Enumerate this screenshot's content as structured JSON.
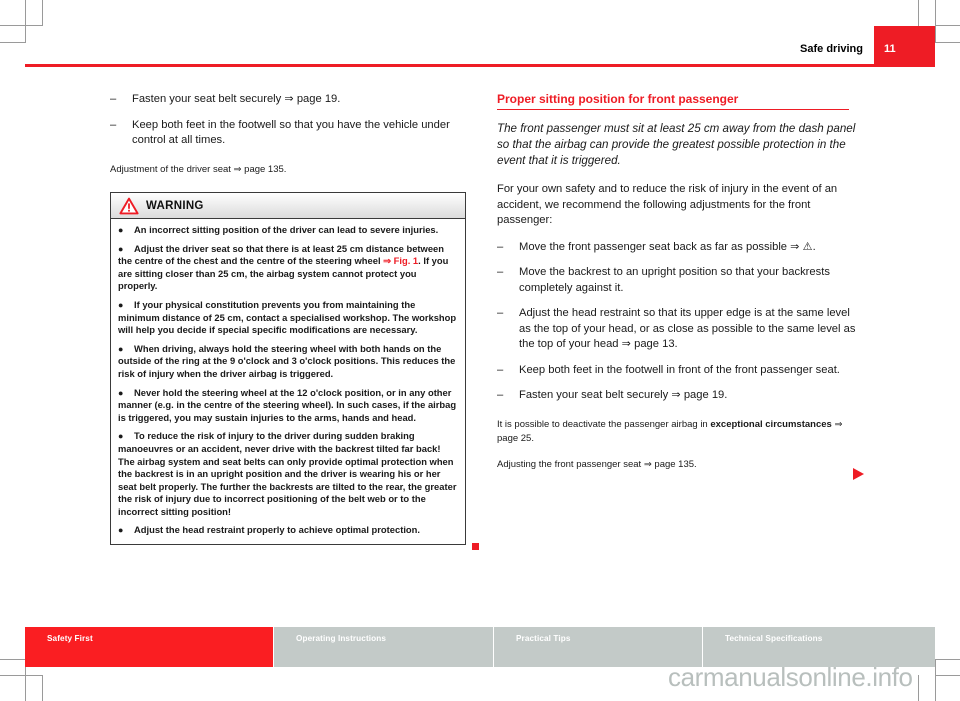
{
  "header": {
    "title": "Safe driving",
    "page_number": "11"
  },
  "left_column": {
    "dash_items": [
      "Fasten your seat belt securely ⇒ page 19.",
      "Keep both feet in the footwell so that you have the vehicle under control at all times."
    ],
    "note": "Adjustment of the driver seat ⇒ page 135.",
    "warning": {
      "icon": "warning-triangle-icon",
      "title": "WARNING",
      "items": [
        {
          "text": "An incorrect sitting position of the driver can lead to severe injuries."
        },
        {
          "text_before": "Adjust the driver seat so that there is at least 25 cm distance between the centre of the chest and the centre of the steering wheel ",
          "ref": "⇒ Fig. 1",
          "text_after": ". If you are sitting closer than 25 cm, the airbag system cannot protect you properly."
        },
        {
          "text": "If your physical constitution prevents you from maintaining the minimum distance of 25 cm, contact a specialised workshop. The workshop will help you decide if special specific modifications are necessary."
        },
        {
          "text": "When driving, always hold the steering wheel with both hands on the outside of the ring at the 9 o'clock and 3 o'clock positions. This reduces the risk of injury when the driver airbag is triggered."
        },
        {
          "text": "Never hold the steering wheel at the 12 o'clock position, or in any other manner (e.g. in the centre of the steering wheel). In such cases, if the airbag is triggered, you may sustain injuries to the arms, hands and head."
        },
        {
          "text": "To reduce the risk of injury to the driver during sudden braking manoeuvres or an accident, never drive with the backrest tilted far back! The airbag system and seat belts can only provide optimal protection when the backrest is in an upright position and the driver is wearing his or her seat belt properly. The further the backrests are tilted to the rear, the greater the risk of injury due to incorrect positioning of the belt web or to the incorrect sitting position!"
        },
        {
          "text": "Adjust the head restraint properly to achieve optimal protection."
        }
      ]
    }
  },
  "right_column": {
    "heading": "Proper sitting position for front passenger",
    "lead": "The front passenger must sit at least 25 cm away from the dash panel so that the airbag can provide the greatest possible protection in the event that it is triggered.",
    "intro": "For your own safety and to reduce the risk of injury in the event of an accident, we recommend the following adjustments for the front passenger:",
    "dash_items": [
      "Move the front passenger seat back as far as possible ⇒ ⚠.",
      "Move the backrest to an upright position so that your backrests completely against it.",
      "Adjust the head restraint so that its upper edge is at the same level as the top of your head, or as close as possible to the same level as the top of your head ⇒ page 13.",
      "Keep both feet in the footwell in front of the front passenger seat.",
      "Fasten your seat belt securely ⇒ page 19."
    ],
    "deactivate_note": {
      "before": "It is possible to deactivate the passenger airbag in ",
      "bold": "exceptional circumstances",
      "after": " ⇒ page 25."
    },
    "adjusting_note": "Adjusting the front passenger seat ⇒ page 135."
  },
  "footer": {
    "tabs": [
      {
        "label": "Safety First",
        "active": true
      },
      {
        "label": "Operating Instructions",
        "active": false
      },
      {
        "label": "Practical Tips",
        "active": false
      },
      {
        "label": "Technical Specifications",
        "active": false
      }
    ]
  },
  "watermark": "carmanualsonline.info",
  "colors": {
    "brand_red": "#ee1c25",
    "footer_red": "#fa1e22",
    "footer_gray": "#c3cac8",
    "watermark_gray": "#b8bfbd"
  }
}
